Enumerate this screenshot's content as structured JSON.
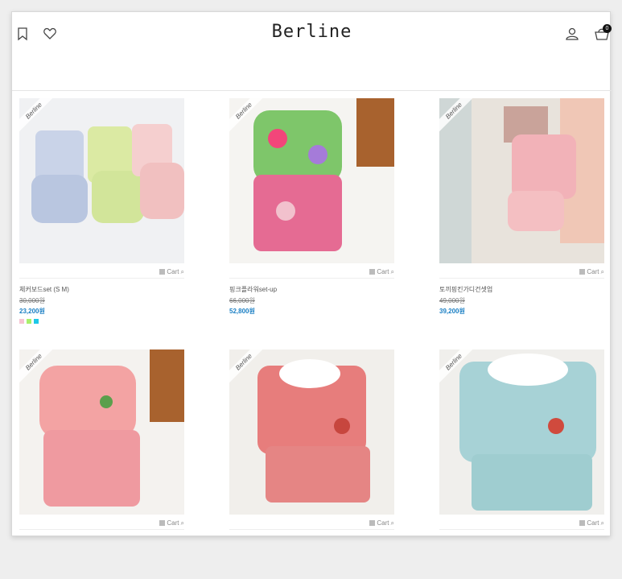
{
  "header": {
    "logo": "Berline",
    "cart_count": "0"
  },
  "products": [
    {
      "name": "체커보드set (S M)",
      "old_price": "30,000원",
      "price": "23,200원",
      "cart_label": "Cart",
      "badge": "Berline",
      "swatches": [
        "#f6c5d3",
        "#a9f06b",
        "#1ec8e8"
      ]
    },
    {
      "name": "핑크플라워set-up",
      "old_price": "66,000원",
      "price": "52,800원",
      "cart_label": "Cart",
      "badge": "Berline",
      "swatches": []
    },
    {
      "name": "토끼핑킨가디건셋업",
      "old_price": "49,000원",
      "price": "39,200원",
      "cart_label": "Cart",
      "badge": "Berline",
      "swatches": []
    },
    {
      "name": "",
      "old_price": "",
      "price": "",
      "cart_label": "Cart",
      "badge": "Berline",
      "swatches": []
    },
    {
      "name": "",
      "old_price": "",
      "price": "",
      "cart_label": "Cart",
      "badge": "Berline",
      "swatches": []
    },
    {
      "name": "",
      "old_price": "",
      "price": "",
      "cart_label": "Cart",
      "badge": "Berline",
      "swatches": []
    }
  ]
}
